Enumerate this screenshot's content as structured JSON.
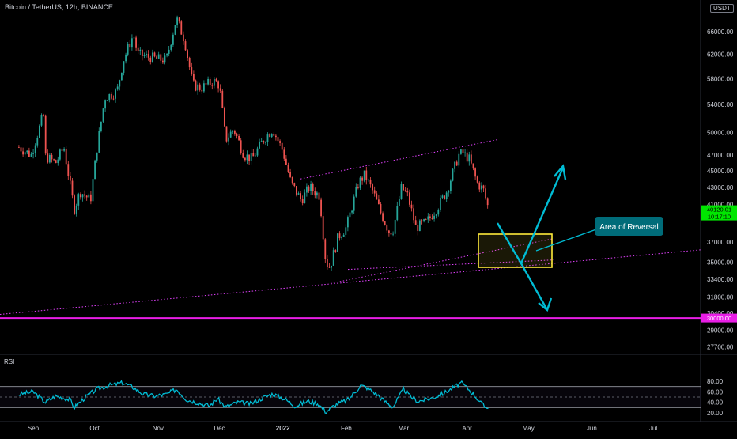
{
  "header": {
    "symbol": "Bitcoin / TetherUS, 12h, BINANCE",
    "currency": "USDT"
  },
  "rsi_label": "RSI",
  "annotation": {
    "text": "Area of Reversal"
  },
  "colors": {
    "up": "#26a69a",
    "down": "#ef5350",
    "pattern": "#e040fb",
    "support": "#e91ee6",
    "arrow": "#00bcd4",
    "zone": "#ffeb3b",
    "label_bg": "#006c79",
    "rsi": "#00bcd4",
    "price_up": "#00e600"
  },
  "chart_data": [
    {
      "type": "candlestick",
      "x_ticks": [
        "Sep",
        "Oct",
        "Nov",
        "Dec",
        "2022",
        "Feb",
        "Mar",
        "Apr",
        "May",
        "Jun",
        "Jul"
      ],
      "y_ticks": [
        "66000.00",
        "62000.00",
        "58000.00",
        "54000.00",
        "50000.00",
        "47000.00",
        "45000.00",
        "43000.00",
        "41000.00",
        "37000.00",
        "35000.00",
        "33400.00",
        "31800.00",
        "30400.00",
        "29000.00",
        "27700.00"
      ],
      "y_scale": "log",
      "ylim": [
        27000,
        72000
      ],
      "last_price": "40120.01",
      "countdown": "10:17:10",
      "support_level": "30000.00",
      "top_partial_label": "7",
      "closes": [
        {
          "date": "2021-08-25",
          "close": 48000
        },
        {
          "date": "2021-08-31",
          "close": 47000
        },
        {
          "date": "2021-09-06",
          "close": 52600
        },
        {
          "date": "2021-09-07",
          "close": 46800
        },
        {
          "date": "2021-09-12",
          "close": 46000
        },
        {
          "date": "2021-09-16",
          "close": 48000
        },
        {
          "date": "2021-09-21",
          "close": 40500
        },
        {
          "date": "2021-09-24",
          "close": 42500
        },
        {
          "date": "2021-09-29",
          "close": 41500
        },
        {
          "date": "2021-10-02",
          "close": 47600
        },
        {
          "date": "2021-10-06",
          "close": 55000
        },
        {
          "date": "2021-10-12",
          "close": 56000
        },
        {
          "date": "2021-10-15",
          "close": 61000
        },
        {
          "date": "2021-10-20",
          "close": 65500
        },
        {
          "date": "2021-10-22",
          "close": 62000
        },
        {
          "date": "2021-10-28",
          "close": 61500
        },
        {
          "date": "2021-11-01",
          "close": 61200
        },
        {
          "date": "2021-11-05",
          "close": 61000
        },
        {
          "date": "2021-11-10",
          "close": 68500
        },
        {
          "date": "2021-11-14",
          "close": 64400
        },
        {
          "date": "2021-11-18",
          "close": 57000
        },
        {
          "date": "2021-11-22",
          "close": 56500
        },
        {
          "date": "2021-11-28",
          "close": 57600
        },
        {
          "date": "2021-12-01",
          "close": 57000
        },
        {
          "date": "2021-12-04",
          "close": 49000
        },
        {
          "date": "2021-12-08",
          "close": 50500
        },
        {
          "date": "2021-12-13",
          "close": 47000
        },
        {
          "date": "2021-12-17",
          "close": 46500
        },
        {
          "date": "2021-12-22",
          "close": 48800
        },
        {
          "date": "2021-12-27",
          "close": 50500
        },
        {
          "date": "2022-01-01",
          "close": 47500
        },
        {
          "date": "2022-01-05",
          "close": 43500
        },
        {
          "date": "2022-01-10",
          "close": 41500
        },
        {
          "date": "2022-01-14",
          "close": 43000
        },
        {
          "date": "2022-01-19",
          "close": 42000
        },
        {
          "date": "2022-01-22",
          "close": 35000
        },
        {
          "date": "2022-01-24",
          "close": 34500
        },
        {
          "date": "2022-01-28",
          "close": 37500
        },
        {
          "date": "2022-02-01",
          "close": 38500
        },
        {
          "date": "2022-02-07",
          "close": 43500
        },
        {
          "date": "2022-02-10",
          "close": 44500
        },
        {
          "date": "2022-02-14",
          "close": 42500
        },
        {
          "date": "2022-02-18",
          "close": 40000
        },
        {
          "date": "2022-02-22",
          "close": 38000
        },
        {
          "date": "2022-02-24",
          "close": 38300
        },
        {
          "date": "2022-02-28",
          "close": 43000
        },
        {
          "date": "2022-03-03",
          "close": 42000
        },
        {
          "date": "2022-03-07",
          "close": 38500
        },
        {
          "date": "2022-03-12",
          "close": 39000
        },
        {
          "date": "2022-03-17",
          "close": 40500
        },
        {
          "date": "2022-03-22",
          "close": 42500
        },
        {
          "date": "2022-03-28",
          "close": 47000
        },
        {
          "date": "2022-03-30",
          "close": 47200
        },
        {
          "date": "2022-04-02",
          "close": 46500
        },
        {
          "date": "2022-04-06",
          "close": 43500
        },
        {
          "date": "2022-04-09",
          "close": 42700
        },
        {
          "date": "2022-04-12",
          "close": 40120
        }
      ]
    },
    {
      "type": "line",
      "title": "RSI",
      "y_ticks": [
        "80.00",
        "60.00",
        "40.00",
        "20.00"
      ],
      "ylim": [
        15,
        85
      ],
      "bands": [
        70,
        50,
        30
      ],
      "points": [
        {
          "date": "2021-08-25",
          "rsi": 55
        },
        {
          "date": "2021-09-01",
          "rsi": 60
        },
        {
          "date": "2021-09-07",
          "rsi": 40
        },
        {
          "date": "2021-09-12",
          "rsi": 52
        },
        {
          "date": "2021-09-19",
          "rsi": 45
        },
        {
          "date": "2021-09-21",
          "rsi": 30
        },
        {
          "date": "2021-09-26",
          "rsi": 48
        },
        {
          "date": "2021-10-02",
          "rsi": 65
        },
        {
          "date": "2021-10-08",
          "rsi": 72
        },
        {
          "date": "2021-10-15",
          "rsi": 77
        },
        {
          "date": "2021-10-20",
          "rsi": 68
        },
        {
          "date": "2021-10-25",
          "rsi": 55
        },
        {
          "date": "2021-10-30",
          "rsi": 52
        },
        {
          "date": "2021-11-05",
          "rsi": 55
        },
        {
          "date": "2021-11-10",
          "rsi": 65
        },
        {
          "date": "2021-11-15",
          "rsi": 45
        },
        {
          "date": "2021-11-20",
          "rsi": 40
        },
        {
          "date": "2021-11-26",
          "rsi": 33
        },
        {
          "date": "2021-11-30",
          "rsi": 47
        },
        {
          "date": "2021-12-04",
          "rsi": 31
        },
        {
          "date": "2021-12-10",
          "rsi": 40
        },
        {
          "date": "2021-12-16",
          "rsi": 37
        },
        {
          "date": "2021-12-23",
          "rsi": 50
        },
        {
          "date": "2021-12-27",
          "rsi": 56
        },
        {
          "date": "2022-01-02",
          "rsi": 46
        },
        {
          "date": "2022-01-07",
          "rsi": 33
        },
        {
          "date": "2022-01-13",
          "rsi": 42
        },
        {
          "date": "2022-01-18",
          "rsi": 38
        },
        {
          "date": "2022-01-22",
          "rsi": 22
        },
        {
          "date": "2022-01-27",
          "rsi": 36
        },
        {
          "date": "2022-02-02",
          "rsi": 45
        },
        {
          "date": "2022-02-08",
          "rsi": 72
        },
        {
          "date": "2022-02-11",
          "rsi": 68
        },
        {
          "date": "2022-02-16",
          "rsi": 55
        },
        {
          "date": "2022-02-21",
          "rsi": 38
        },
        {
          "date": "2022-02-24",
          "rsi": 32
        },
        {
          "date": "2022-03-01",
          "rsi": 65
        },
        {
          "date": "2022-03-04",
          "rsi": 52
        },
        {
          "date": "2022-03-08",
          "rsi": 42
        },
        {
          "date": "2022-03-14",
          "rsi": 47
        },
        {
          "date": "2022-03-20",
          "rsi": 56
        },
        {
          "date": "2022-03-25",
          "rsi": 67
        },
        {
          "date": "2022-03-29",
          "rsi": 77
        },
        {
          "date": "2022-04-01",
          "rsi": 68
        },
        {
          "date": "2022-04-05",
          "rsi": 52
        },
        {
          "date": "2022-04-08",
          "rsi": 38
        },
        {
          "date": "2022-04-10",
          "rsi": 30
        },
        {
          "date": "2022-04-12",
          "rsi": 33
        }
      ]
    }
  ]
}
